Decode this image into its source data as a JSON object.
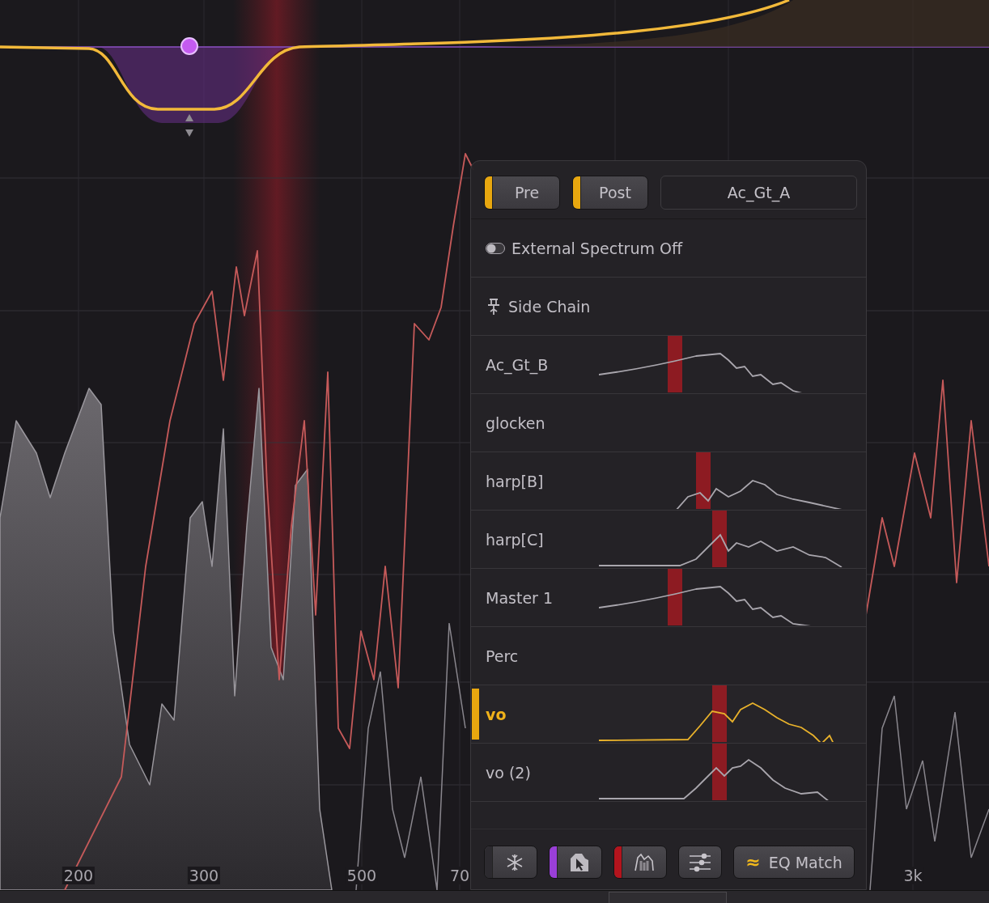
{
  "analyzer": {
    "freq_labels": [
      {
        "text": "200"
      },
      {
        "text": "300"
      },
      {
        "text": "500"
      },
      {
        "text": "70"
      },
      {
        "text": "3k"
      }
    ]
  },
  "panel": {
    "header": {
      "toggles": [
        {
          "label": "Pre",
          "on": true
        },
        {
          "label": "Post",
          "on": true
        }
      ],
      "source": "Ac_Gt_A"
    },
    "external_spectrum": {
      "label": "External Spectrum Off",
      "on": false
    },
    "side_chain": {
      "label": "Side Chain"
    },
    "tracks": [
      {
        "name": "Ac_Gt_B",
        "selected": false,
        "spectrum": true
      },
      {
        "name": "glocken",
        "selected": false,
        "spectrum": false
      },
      {
        "name": "harp[B]",
        "selected": false,
        "spectrum": true
      },
      {
        "name": "harp[C]",
        "selected": false,
        "spectrum": true
      },
      {
        "name": "Master 1",
        "selected": false,
        "spectrum": true
      },
      {
        "name": "Perc",
        "selected": false,
        "spectrum": false
      },
      {
        "name": "vo",
        "selected": true,
        "spectrum": true
      },
      {
        "name": "vo (2)",
        "selected": false,
        "spectrum": true
      }
    ],
    "toolbar": [
      {
        "kind": "freeze",
        "color": "#2c2a2f"
      },
      {
        "kind": "cursor",
        "color": "#9a3fd8"
      },
      {
        "kind": "spectrum",
        "color": "#b3141d"
      },
      {
        "kind": "settings"
      },
      {
        "kind": "match",
        "symbol": "≈",
        "label": "EQ Match"
      }
    ]
  }
}
